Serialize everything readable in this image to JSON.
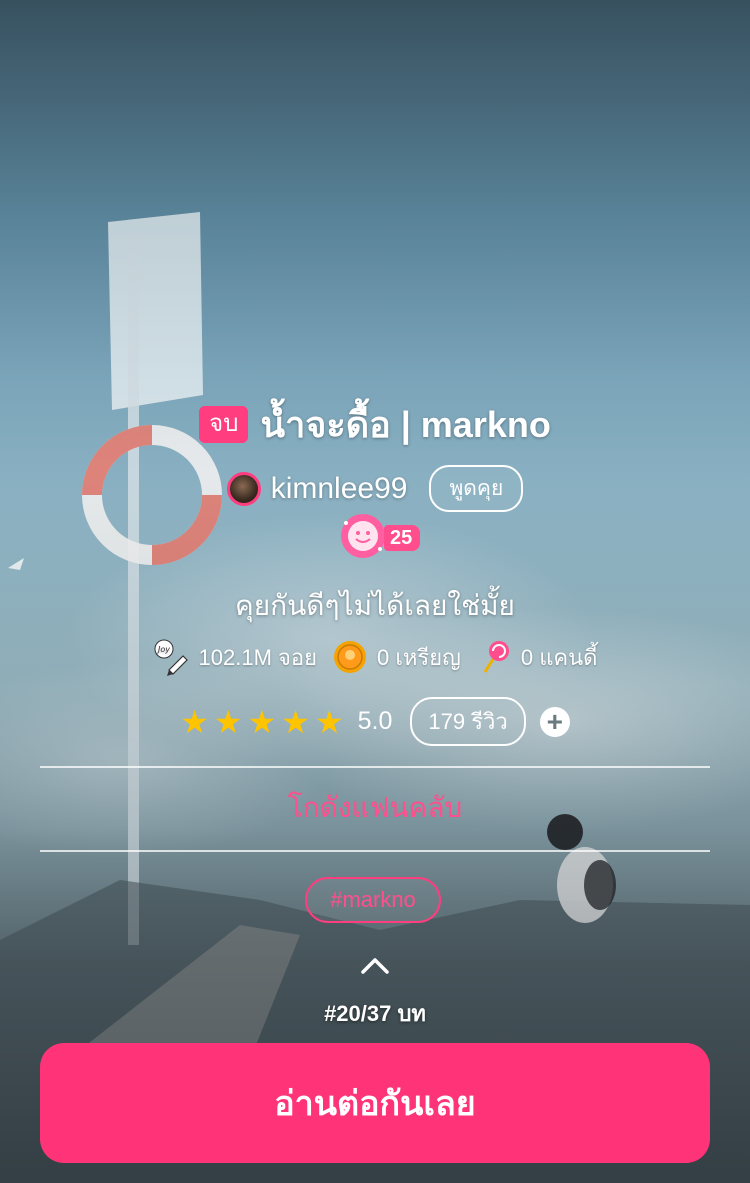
{
  "story": {
    "status_badge": "จบ",
    "title": "น้ำจะดื้อ | markno",
    "author": "kimnlee99",
    "chat_label": "พูดคุย",
    "level": "25",
    "tagline": "คุยกันดีๆไม่ได้เลยใช่มั้ย"
  },
  "stats": {
    "views": "102.1M จอย",
    "coins": "0 เหรียญ",
    "candy": "0 แคนดี้"
  },
  "rating": {
    "stars": 5,
    "value": "5.0",
    "reviews_label": "179 รีวิว"
  },
  "fanclub_label": "โกดังแฟนคลับ",
  "hashtag": "#markno",
  "chapter_progress": "#20/37 บท",
  "read_button": "อ่านต่อกันเลย",
  "icons": {
    "view": "joy-pen-icon",
    "coin": "coin-icon",
    "candy": "lollipop-icon",
    "add": "plus-circle-icon",
    "chevron": "chevron-up-icon"
  },
  "colors": {
    "accent": "#ff3478",
    "star": "#ffc400"
  }
}
